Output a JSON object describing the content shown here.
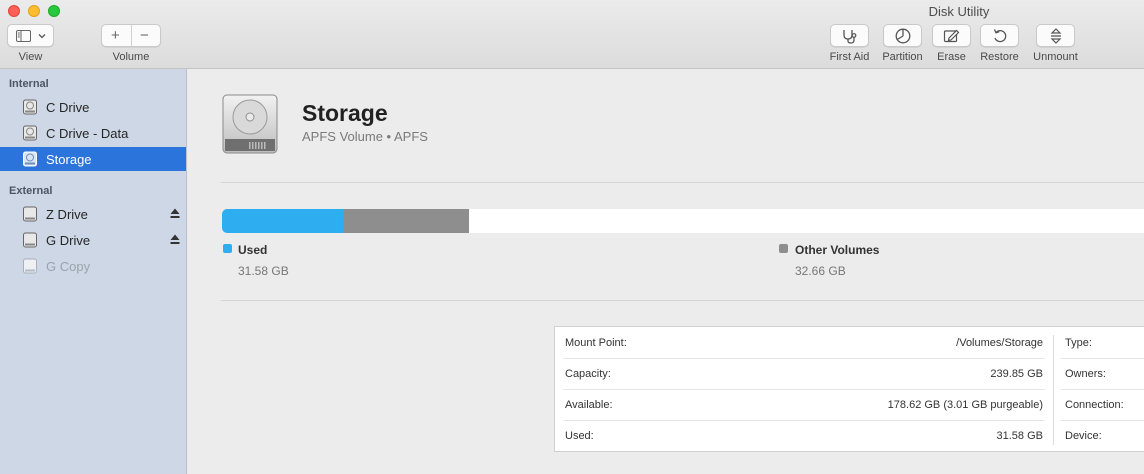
{
  "window": {
    "title": "Disk Utility"
  },
  "toolbar": {
    "view_label": "View",
    "volume_label": "Volume",
    "add_symbol": "+",
    "remove_symbol": "−",
    "first_aid_label": "First Aid",
    "partition_label": "Partition",
    "erase_label": "Erase",
    "restore_label": "Restore",
    "unmount_label": "Unmount"
  },
  "sidebar": {
    "internal_header": "Internal",
    "external_header": "External",
    "internal_items": [
      {
        "label": "C Drive"
      },
      {
        "label": "C Drive - Data"
      },
      {
        "label": "Storage",
        "selected": true
      }
    ],
    "external_items": [
      {
        "label": "Z Drive",
        "eject": true
      },
      {
        "label": "G Drive",
        "eject": true
      },
      {
        "label": "G Copy",
        "disabled": true
      }
    ]
  },
  "volume": {
    "name": "Storage",
    "subtitle": "APFS Volume • APFS"
  },
  "usage": {
    "used_fraction": 0.1317,
    "other_fraction": 0.1362,
    "used_label": "Used",
    "used_value": "31.58 GB",
    "other_label": "Other Volumes",
    "other_value": "32.66 GB",
    "colors": {
      "used": "#2eaef0",
      "other": "#8e8e8e",
      "free": "#ffffff"
    }
  },
  "info": {
    "mount_point_key": "Mount Point:",
    "mount_point_value": "/Volumes/Storage",
    "capacity_key": "Capacity:",
    "capacity_value": "239.85 GB",
    "available_key": "Available:",
    "available_value": "178.62 GB (3.01 GB purgeable)",
    "used_key": "Used:",
    "used_value": "31.58 GB",
    "type_key": "Type:",
    "owners_key": "Owners:",
    "connection_key": "Connection:",
    "device_key": "Device:"
  },
  "icons": {
    "first_aid": "stethoscope-icon",
    "partition": "pie-icon",
    "erase": "eraser-icon",
    "restore": "restore-icon",
    "unmount": "unmount-icon"
  }
}
